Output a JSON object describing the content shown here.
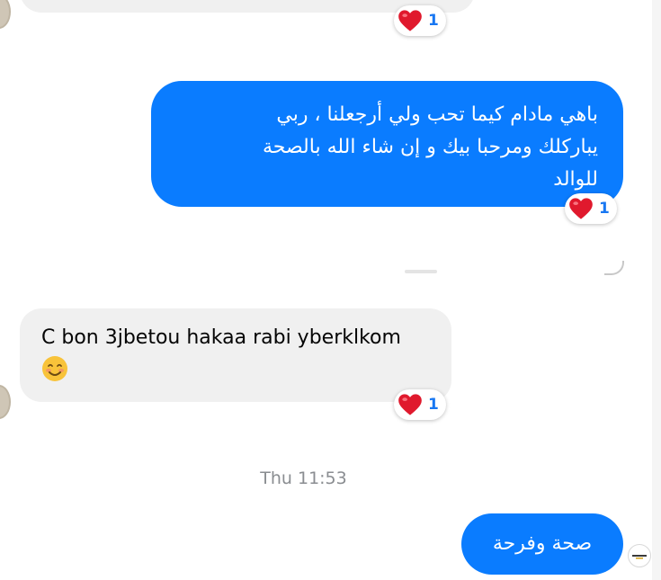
{
  "messages": [
    {
      "id": "m1",
      "direction": "incoming",
      "text": "",
      "reaction": {
        "icon": "heart-icon",
        "count": "1"
      }
    },
    {
      "id": "m2",
      "direction": "outgoing",
      "lines": [
        "باهي مادام كيما تحب ولي أرجعلنا ، ربي",
        "يباركلك ومرحبا بيك و إن شاء الله بالصحة",
        "للوالد"
      ],
      "reaction": {
        "icon": "heart-icon",
        "count": "1"
      }
    },
    {
      "id": "m3",
      "direction": "incoming",
      "text": "C bon 3jbetou hakaa rabi yberklkom",
      "emoji": "smiling-face-icon",
      "reaction": {
        "icon": "heart-icon",
        "count": "1"
      }
    },
    {
      "id": "m4",
      "direction": "outgoing",
      "text": "صحة وفرحة"
    }
  ],
  "timestamp": "Thu 11:53",
  "colors": {
    "outgoing_bubble": "#0a7cff",
    "incoming_bubble": "#f0f0f0",
    "reaction_count": "#1877f2",
    "heart": "#e0192d",
    "timestamp": "#8a8d91"
  }
}
